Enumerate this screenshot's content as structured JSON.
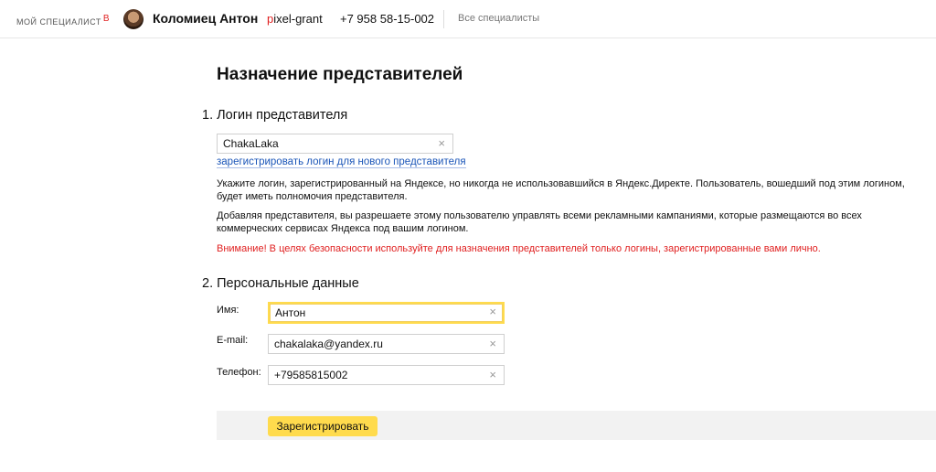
{
  "header": {
    "brand": "мой специалист",
    "brand_beta": "β",
    "user_name": "Коломиец Антон",
    "login_first": "p",
    "login_rest": "ixel-grant",
    "phone": "+7 958 58-15-002",
    "all_specialists": "Все специалисты"
  },
  "page": {
    "title": "Назначение представителей"
  },
  "section1": {
    "title": "1. Логин представителя",
    "login_value": "ChakaLaka",
    "register_link": "зарегистрировать логин для нового представителя",
    "para1": "Укажите логин, зарегистрированный на Яндексе, но никогда не использовавшийся в Яндекс.Директе. Пользователь, вошедший под этим логином, будет иметь полномочия представителя.",
    "para2": "Добавляя представителя, вы разрешаете этому пользователю управлять всеми рекламными кампаниями, которые размещаются во всех коммерческих сервисах Яндекса под вашим логином.",
    "warning": "Внимание! В целях безопасности используйте для назначения представителей только логины, зарегистрированные вами лично."
  },
  "section2": {
    "title": "2. Персональные данные",
    "name_label": "Имя:",
    "name_value": "Антон",
    "email_label": "E-mail:",
    "email_value": "chakalaka@yandex.ru",
    "phone_label": "Телефон:",
    "phone_value": "+79585815002"
  },
  "actions": {
    "submit": "Зарегистрировать"
  },
  "icons": {
    "clear": "×"
  },
  "colors": {
    "accent": "#ffdb4d",
    "link": "#1a55b8",
    "warning": "#e02020"
  }
}
